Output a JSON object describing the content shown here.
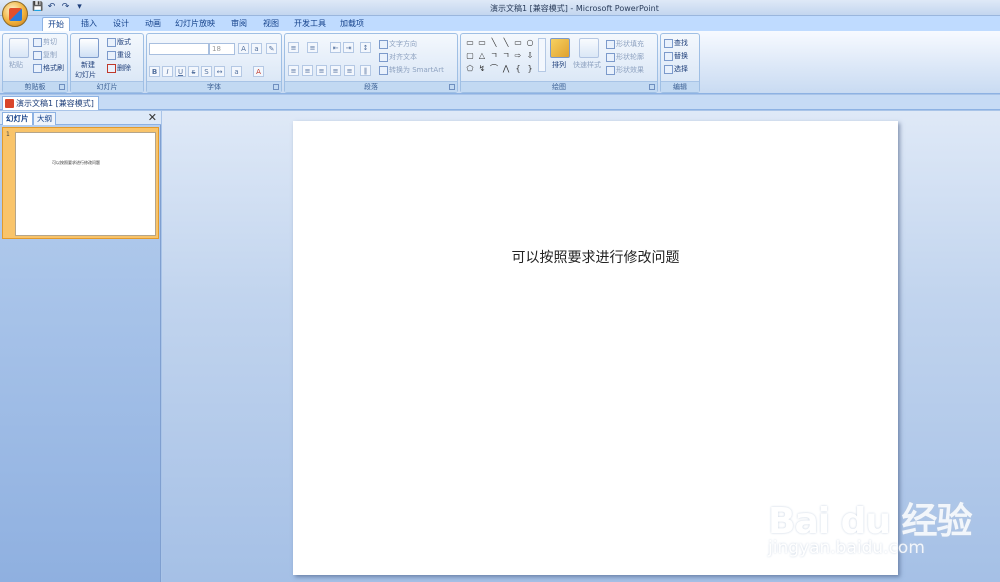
{
  "window": {
    "title": "演示文稿1 [兼容模式] - Microsoft PowerPoint",
    "quick_access": [
      "💾",
      "↶",
      "↷",
      "▾"
    ]
  },
  "ribbon_tabs": [
    "开始",
    "插入",
    "设计",
    "动画",
    "幻灯片放映",
    "审阅",
    "视图",
    "开发工具",
    "加载项"
  ],
  "ribbon": {
    "clipboard": {
      "label": "剪贴板",
      "paste": "粘贴",
      "cut": "剪切",
      "copy": "复制",
      "format_painter": "格式刷"
    },
    "slides": {
      "label": "幻灯片",
      "new_slide_1": "新建",
      "new_slide_2": "幻灯片",
      "layout": "版式",
      "reset": "重设",
      "delete": "删除"
    },
    "font": {
      "label": "字体",
      "font_name": "",
      "font_size": "18"
    },
    "paragraph": {
      "label": "段落",
      "text_direction": "文字方向",
      "align_text": "对齐文本",
      "convert_smartart": "转换为 SmartArt"
    },
    "drawing": {
      "label": "绘图",
      "arrange": "排列",
      "quick_styles": "快速样式",
      "shape_fill": "形状填充",
      "shape_outline": "形状轮廓",
      "shape_effects": "形状效果"
    },
    "editing": {
      "label": "编辑",
      "find": "查找",
      "replace": "替换",
      "select": "选择"
    }
  },
  "doc_tab": "演示文稿1 [兼容模式]",
  "panel": {
    "tab_slides": "幻灯片",
    "tab_outline": "大纲",
    "slide_number": "1",
    "thumb_text": "可以按照要求进行修改问题"
  },
  "slide": {
    "text": "可以按照要求进行修改问题"
  },
  "watermark": {
    "brand": "Bai du 经验",
    "url": "jingyan.baidu.com"
  }
}
